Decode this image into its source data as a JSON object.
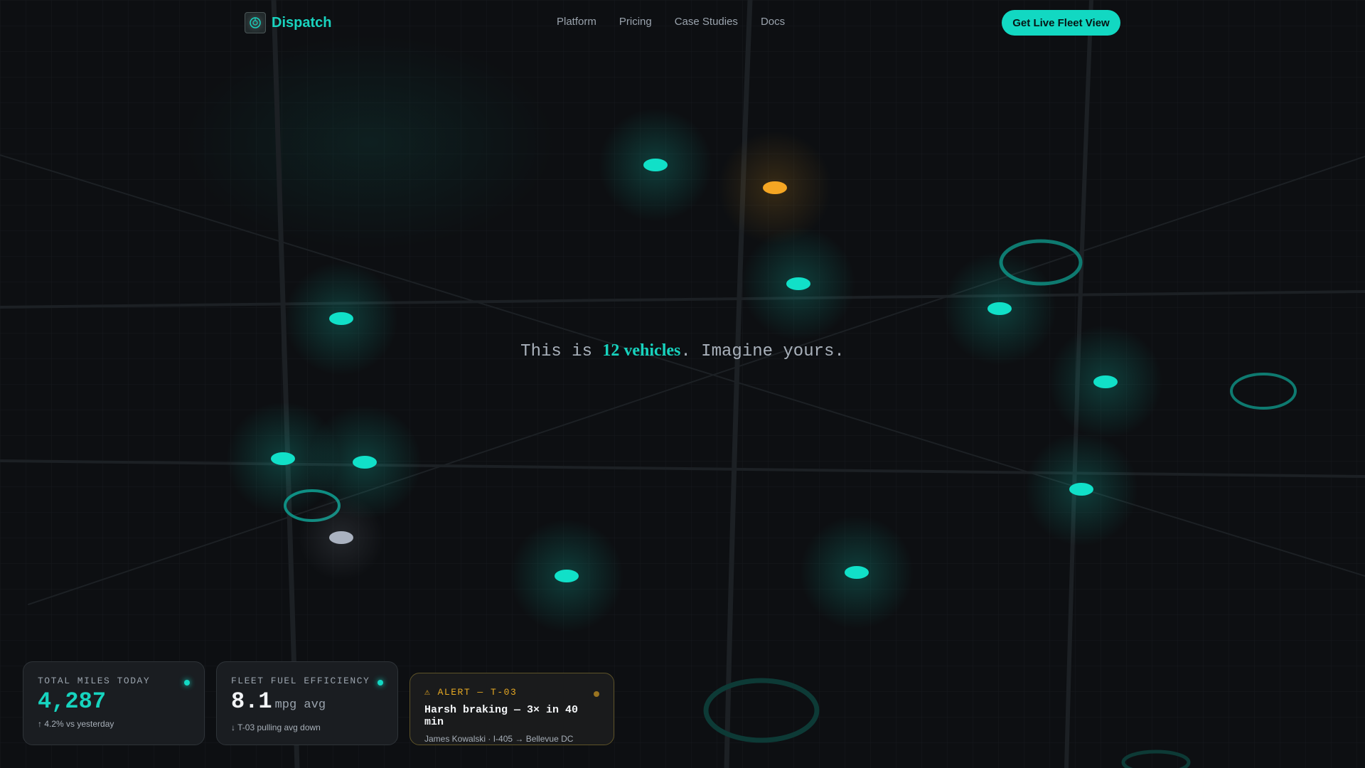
{
  "brand": {
    "name": "Dispatch"
  },
  "nav": {
    "links": [
      "Platform",
      "Pricing",
      "Case Studies",
      "Docs"
    ],
    "cta_label": "Get Live Fleet View"
  },
  "headline": {
    "prefix": "This is ",
    "highlight": "12 vehicles",
    "suffix": ". Imagine yours."
  },
  "colors": {
    "accent": "#12d8c2",
    "vehicle_active": "#11e0c8",
    "vehicle_alert": "#f5a623",
    "vehicle_idle": "#aab2c0",
    "background": "#0d0f12"
  },
  "vehicles": [
    {
      "status": "active"
    },
    {
      "status": "alert"
    },
    {
      "status": "active"
    },
    {
      "status": "active"
    },
    {
      "status": "active"
    },
    {
      "status": "active"
    },
    {
      "status": "active"
    },
    {
      "status": "active"
    },
    {
      "status": "idle"
    },
    {
      "status": "active"
    },
    {
      "status": "active"
    },
    {
      "status": "active"
    },
    {
      "status": "active"
    }
  ],
  "stats": {
    "miles": {
      "label": "TOTAL MILES TODAY",
      "value": "4,287",
      "sub": "↑ 4.2% vs yesterday"
    },
    "fuel": {
      "label": "FLEET FUEL EFFICIENCY",
      "value": "8.1",
      "unit": "mpg avg",
      "sub": "↓ T-03 pulling avg down"
    },
    "alert": {
      "label": "⚠ ALERT — T-03",
      "title": "Harsh braking — 3× in 40 min",
      "sub": "James Kowalski · I-405 → Bellevue DC"
    }
  }
}
